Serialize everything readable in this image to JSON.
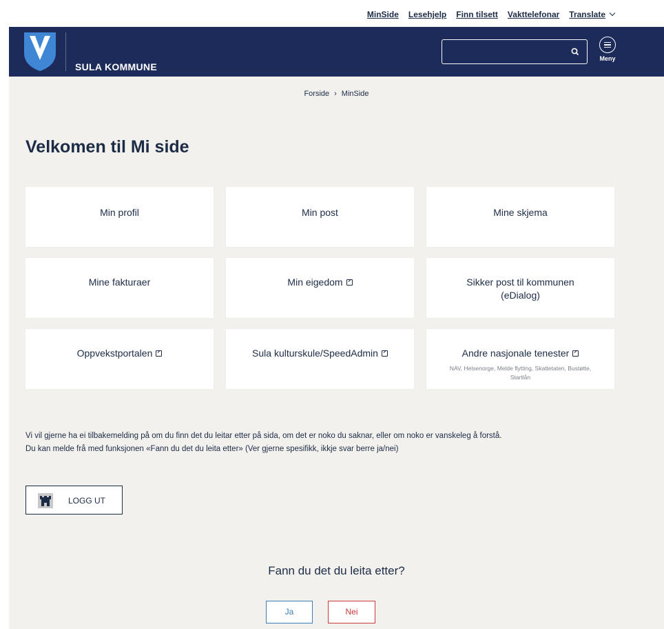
{
  "utility_nav": {
    "links": [
      "MinSide",
      "Lesehjelp",
      "Finn tilsett",
      "Vakttelefonar"
    ],
    "translate": "Translate"
  },
  "header": {
    "brand": "SULA KOMMUNE",
    "search_value": "",
    "menu_label": "Meny"
  },
  "breadcrumb": {
    "home": "Forside",
    "separator": "›",
    "current": "MinSide"
  },
  "page_title": "Velkomen til Mi side",
  "cards": [
    {
      "label": "Min profil",
      "external": false
    },
    {
      "label": "Min post",
      "external": false
    },
    {
      "label": "Mine skjema",
      "external": false
    },
    {
      "label": "Mine fakturaer",
      "external": false
    },
    {
      "label": "Min eigedom",
      "external": true
    },
    {
      "label": "Sikker post til kommunen (eDialog)",
      "external": false
    },
    {
      "label": "Oppvekstportalen",
      "external": true
    },
    {
      "label": "Sula kulturskule/SpeedAdmin",
      "external": true
    },
    {
      "label": "Andre nasjonale tenester",
      "external": true,
      "sub": "NAV, Helsenorge, Melde flytting, Skattetaten, Bustøtte, Startlån"
    }
  ],
  "feedback_text": {
    "line1": "Vi vil gjerne ha ei tilbakemelding på om du finn det du leitar etter på sida, om det er noko du saknar, eller om noko er vanskeleg å forstå.",
    "line2": "Du kan  melde frå med funksjonen «Fann du det du leita etter» (Ver gjerne spesifikk, ikkje svar berre ja/nei)"
  },
  "logout_label": "LOGG UT",
  "found_question": "Fann du det du leita etter?",
  "yes_label": "Ja",
  "no_label": "Nei",
  "colors": {
    "navy": "#1c2b5a",
    "background": "#f2f1ed",
    "brand_blue": "#3f86d4",
    "yes": "#3d7db8",
    "no": "#c83a3a"
  }
}
